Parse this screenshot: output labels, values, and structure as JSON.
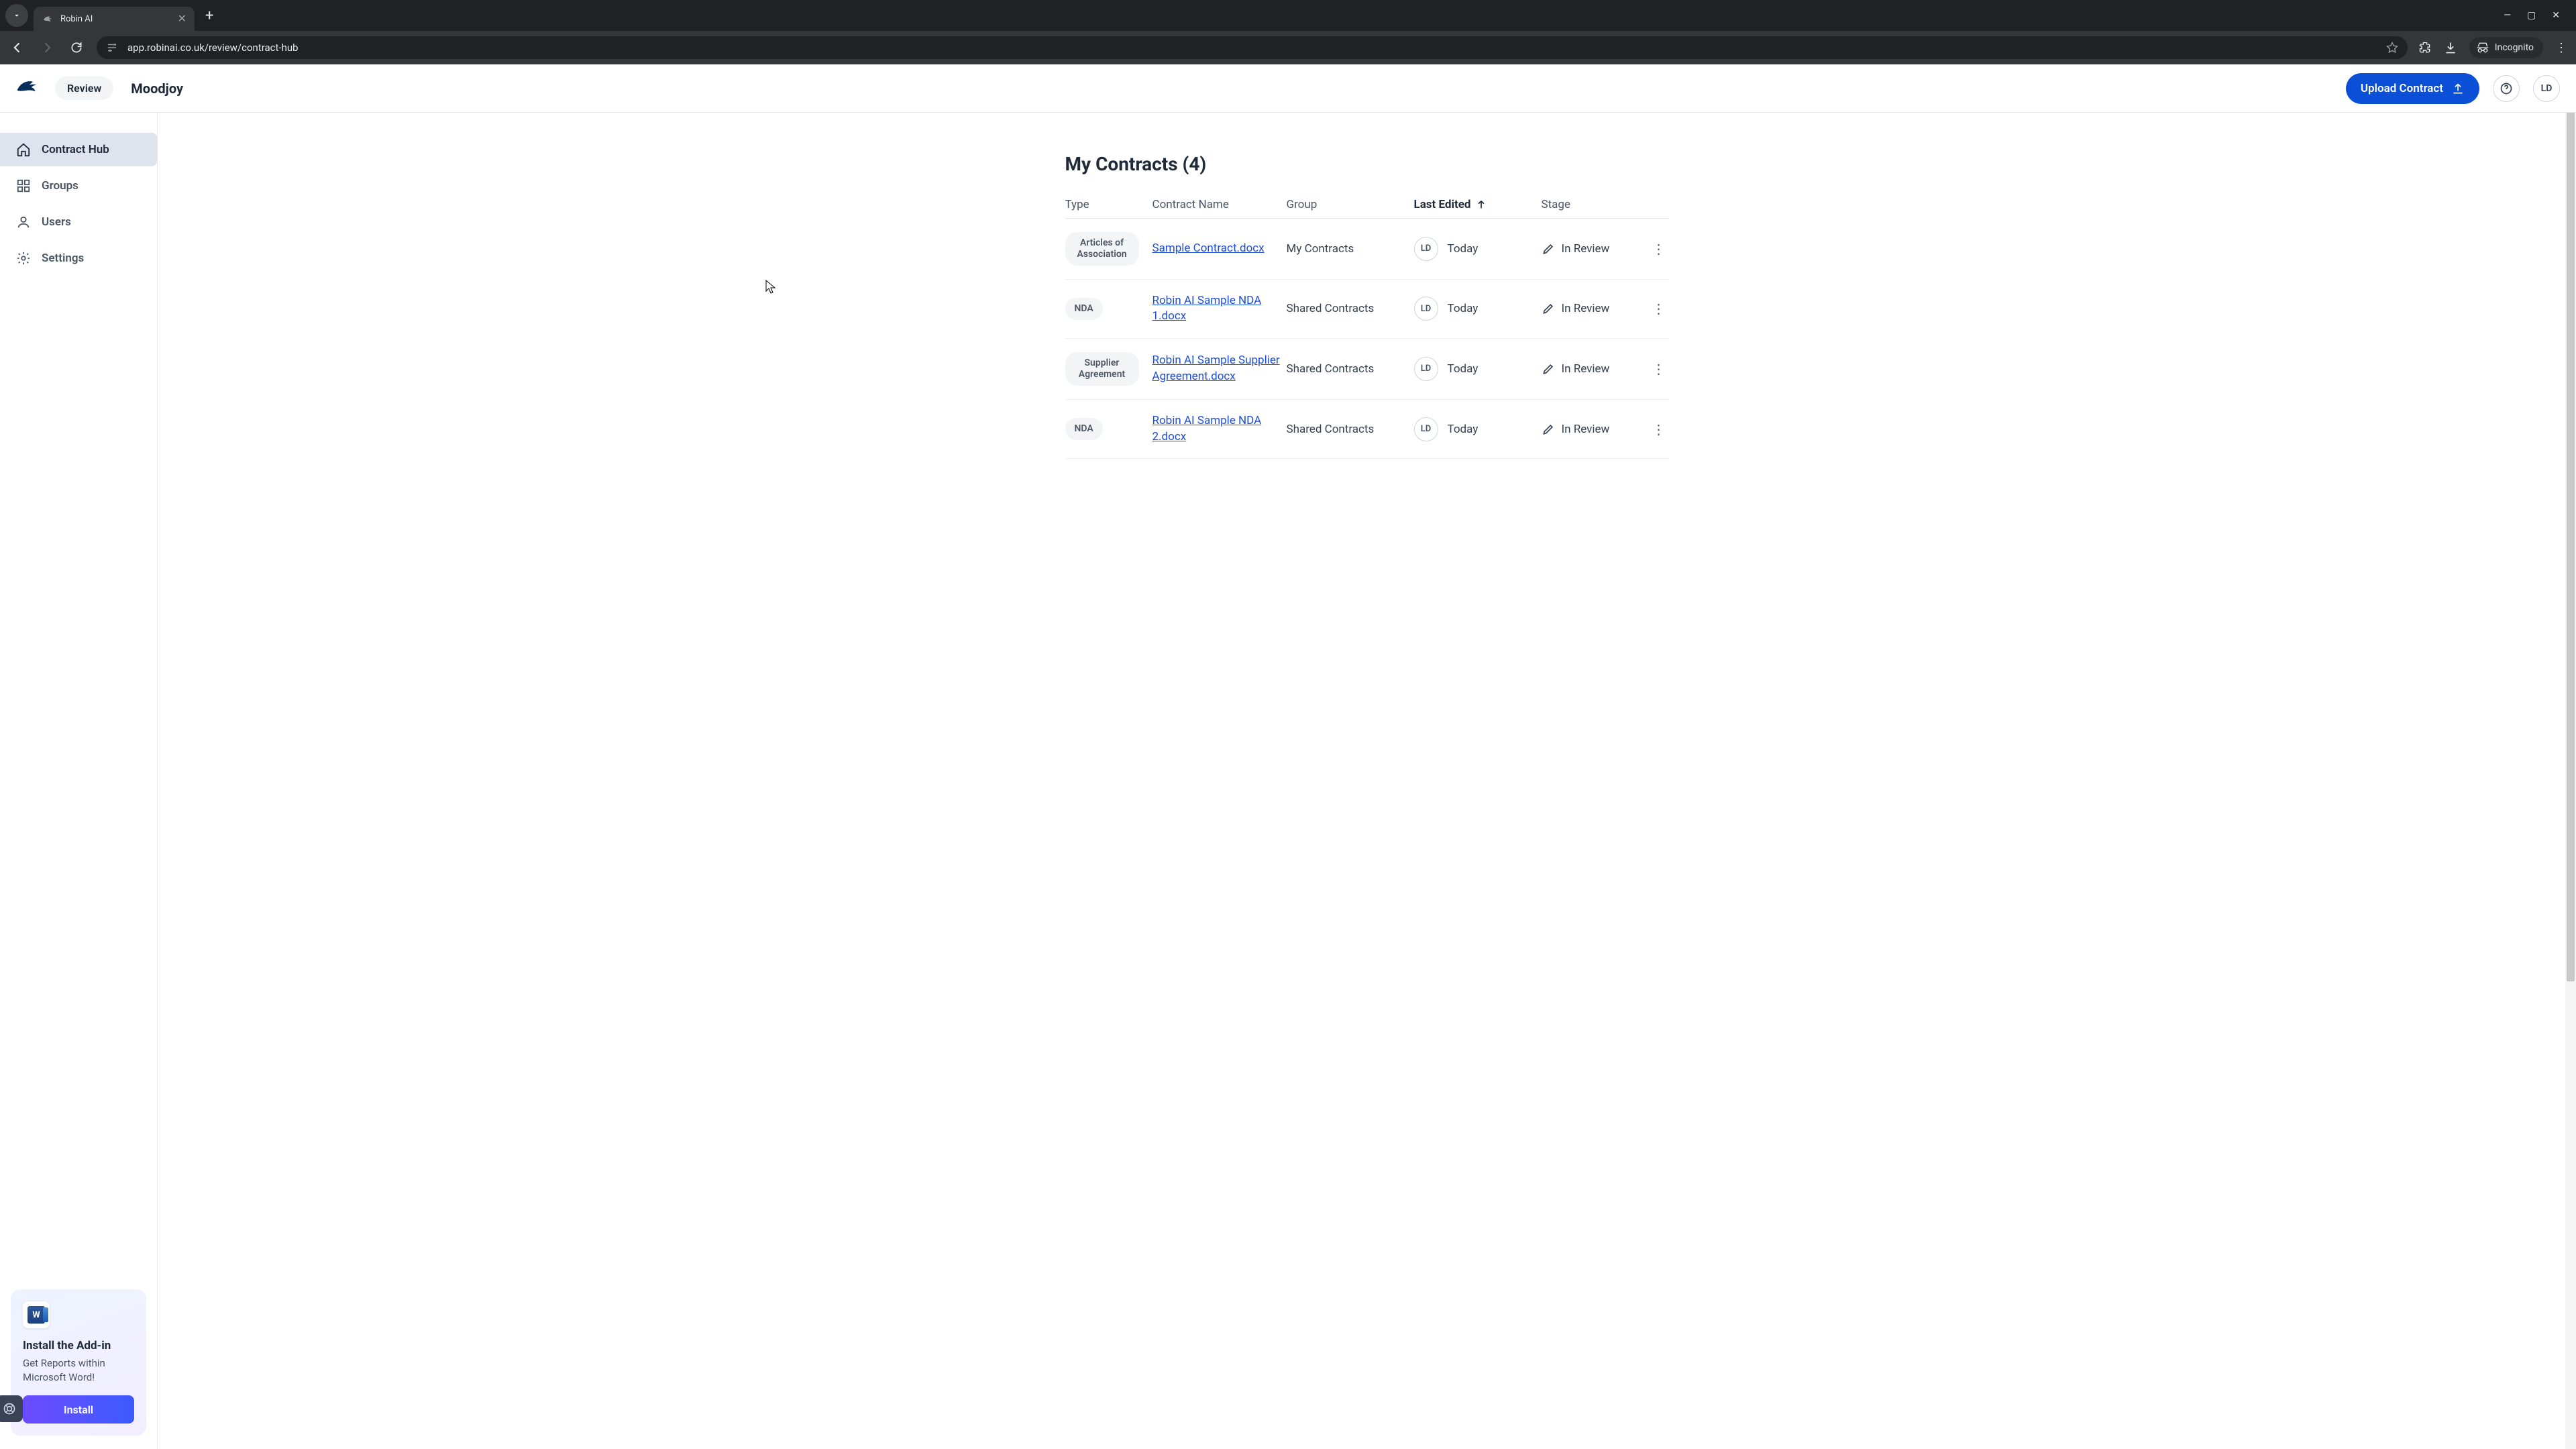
{
  "browser": {
    "tab_title": "Robin AI",
    "url": "app.robinai.co.uk/review/contract-hub",
    "incognito_label": "Incognito"
  },
  "header": {
    "review_label": "Review",
    "org_name": "Moodjoy",
    "upload_label": "Upload Contract",
    "user_initials": "LD"
  },
  "sidebar": {
    "items": [
      {
        "label": "Contract Hub"
      },
      {
        "label": "Groups"
      },
      {
        "label": "Users"
      },
      {
        "label": "Settings"
      }
    ],
    "addin": {
      "title": "Install the Add-in",
      "subtitle": "Get Reports within Microsoft Word!",
      "button": "Install"
    }
  },
  "contracts": {
    "title": "My Contracts (4)",
    "columns": {
      "type": "Type",
      "name": "Contract Name",
      "group": "Group",
      "edited": "Last Edited",
      "stage": "Stage"
    },
    "rows": [
      {
        "type": "Articles of Association",
        "name": "Sample Contract.docx",
        "group": "My Contracts",
        "editor": "LD",
        "edited": "Today",
        "stage": "In Review"
      },
      {
        "type": "NDA",
        "name": "Robin AI Sample NDA 1.docx",
        "group": "Shared Contracts",
        "editor": "LD",
        "edited": "Today",
        "stage": "In Review"
      },
      {
        "type": "Supplier Agreement",
        "name": "Robin AI Sample Supplier Agreement.docx",
        "group": "Shared Contracts",
        "editor": "LD",
        "edited": "Today",
        "stage": "In Review"
      },
      {
        "type": "NDA",
        "name": "Robin AI Sample NDA 2.docx",
        "group": "Shared Contracts",
        "editor": "LD",
        "edited": "Today",
        "stage": "In Review"
      }
    ]
  }
}
